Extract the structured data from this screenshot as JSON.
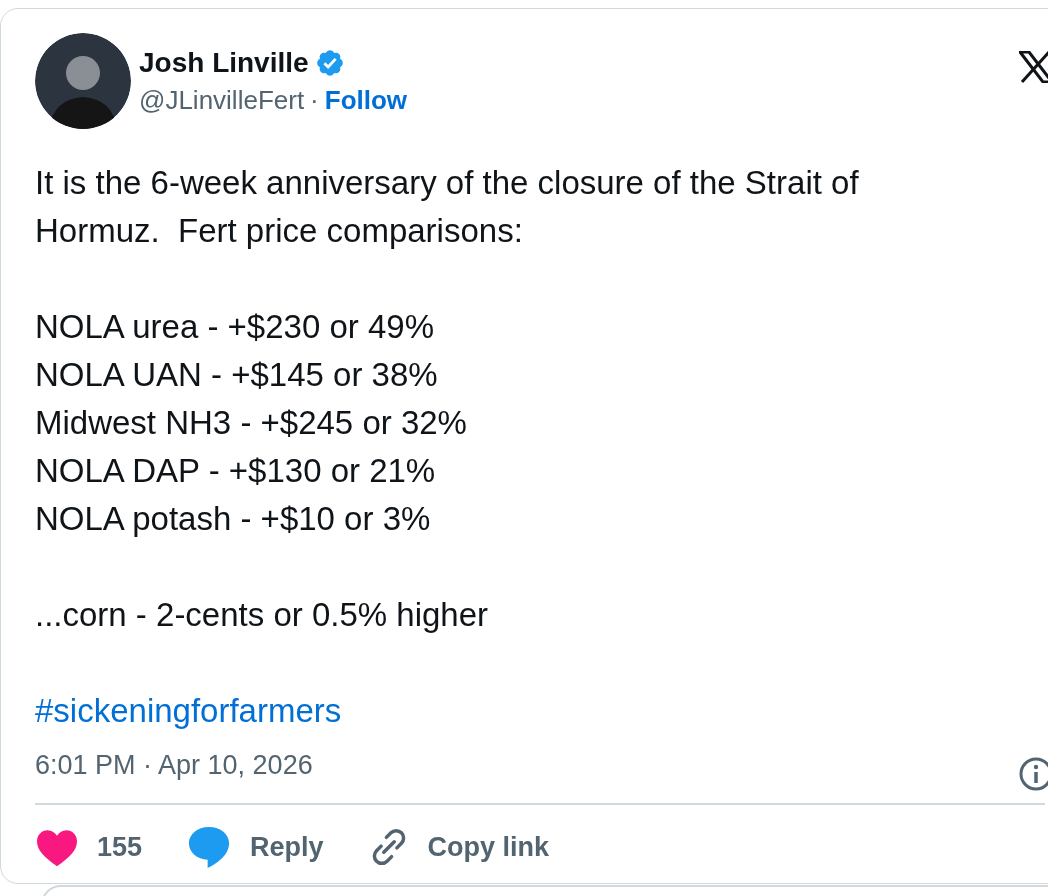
{
  "author": {
    "name": "Josh Linville",
    "verified": true,
    "handle": "@JLinvilleFert",
    "separator": "·",
    "follow": "Follow"
  },
  "paragraphs": [
    [
      "It is the 6-week anniversary of the closure of the Strait of",
      "Hormuz.  Fert price comparisons:"
    ],
    [
      "NOLA urea - +$230 or 49%",
      "NOLA UAN - +$145 or 38%",
      "Midwest NH3 - +$245 or 32%",
      "NOLA DAP - +$130 or 21%",
      "NOLA potash - +$10 or 3%"
    ],
    [
      "...corn - 2-cents or 0.5% higher"
    ]
  ],
  "hashtag": "#sickeningforfarmers",
  "timestamp": "6:01 PM · Apr 10, 2026",
  "actions": [
    {
      "kind": "like",
      "label": "155"
    },
    {
      "kind": "reply",
      "label": "Reply"
    },
    {
      "kind": "copy",
      "label": "Copy link"
    }
  ]
}
